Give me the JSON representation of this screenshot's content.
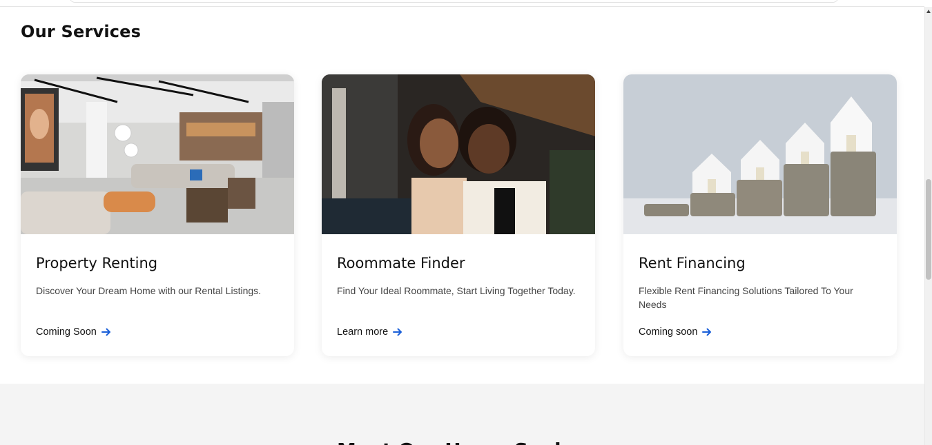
{
  "services": {
    "title": "Our Services",
    "cards": [
      {
        "title": "Property Renting",
        "description": "Discover Your Dream Home with our Rental Listings.",
        "link": "Coming Soon",
        "image": "modern-lounge-interior-photo"
      },
      {
        "title": "Roommate Finder",
        "description": "Find Your Ideal Roommate, Start Living Together Today.",
        "link": "Learn more",
        "image": "two-smiling-women-photo"
      },
      {
        "title": "Rent Financing",
        "description": "Flexible Rent Financing Solutions Tailored To Your Needs",
        "link": "Coming soon",
        "image": "coin-stacks-with-houses-photo"
      }
    ]
  },
  "next_section": {
    "heading": "Meet Our Home Seekers"
  },
  "colors": {
    "accent": "#1a5fd8",
    "lower_bg": "#f4f4f4"
  }
}
